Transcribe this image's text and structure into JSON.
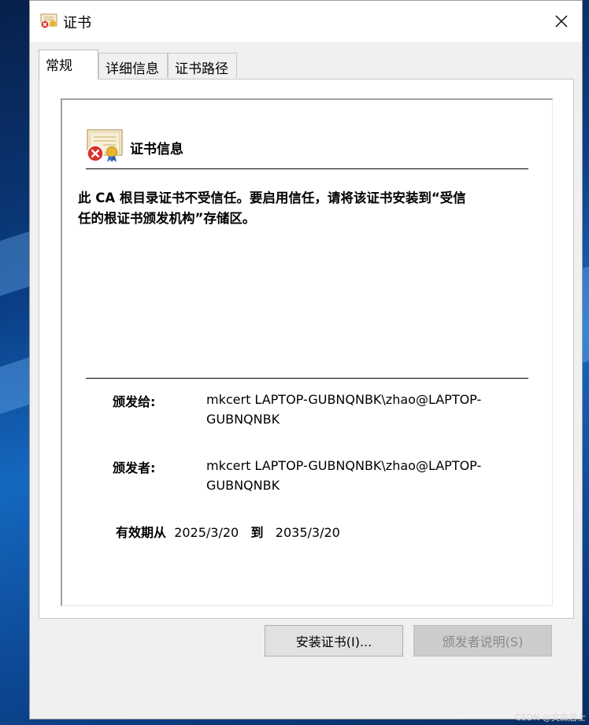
{
  "window": {
    "title": "证书",
    "close_icon": "close-icon"
  },
  "tabs": [
    {
      "label": "常规",
      "active": true
    },
    {
      "label": "详细信息",
      "active": false
    },
    {
      "label": "证书路径",
      "active": false
    }
  ],
  "general": {
    "heading": "证书信息",
    "warning_line1": "此 CA 根目录证书不受信任。要启用信任，请将该证书安装到“受信",
    "warning_line2": "任的根证书颁发机构”存储区。",
    "issued_to_label": "颁发给:",
    "issued_to_line1": "mkcert LAPTOP-GUBNQNBK\\zhao@LAPTOP-",
    "issued_to_line2": "GUBNQNBK",
    "issued_by_label": "颁发者:",
    "issued_by_line1": "mkcert LAPTOP-GUBNQNBK\\zhao@LAPTOP-",
    "issued_by_line2": "GUBNQNBK",
    "valid_from_label": "有效期从",
    "valid_from": "2025/3/20",
    "valid_to_label": "到",
    "valid_to": "2035/3/20"
  },
  "buttons": {
    "install": "安装证书(I)...",
    "issuer_statement": "颁发者说明(S)"
  },
  "watermark": "CSDN @文森居士",
  "colors": {
    "window_bg": "#f0f0f0",
    "panel_bg": "#ffffff",
    "error_red": "#d9302c",
    "desktop_blue": "#0b3f86"
  }
}
